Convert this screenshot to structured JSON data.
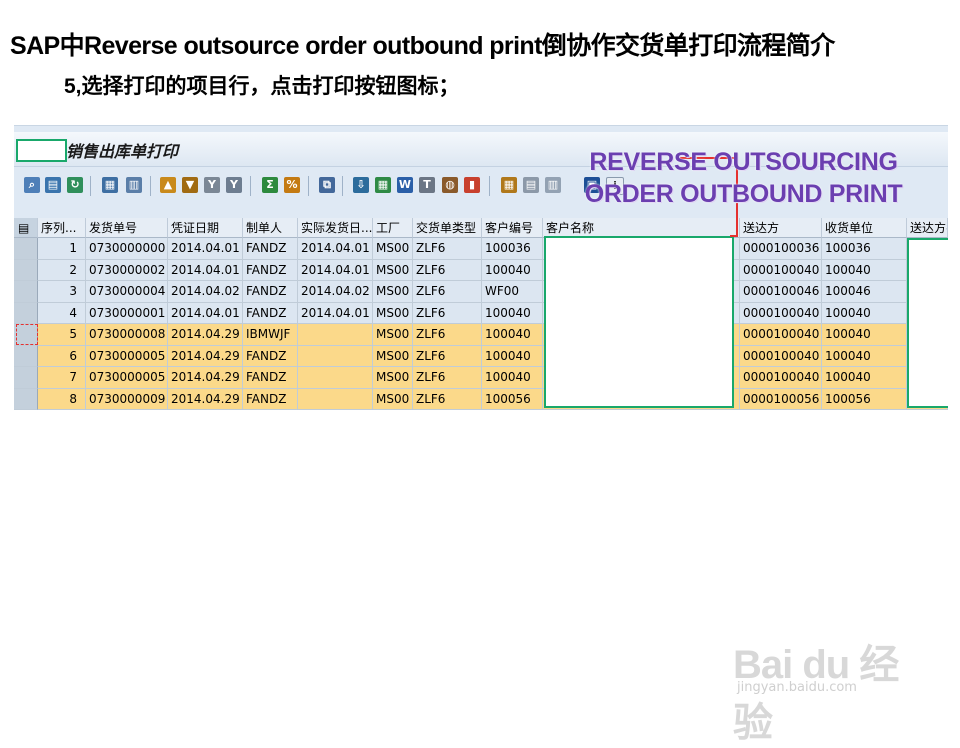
{
  "slide": {
    "title": "SAP中Reverse outsource order outbound print倒协作交货单打印流程简介",
    "step": "5,选择打印的项目行，点击打印按钮图标；"
  },
  "window": {
    "title": "销售出库单打印",
    "watermark_line1": "REVERSE OUTSOURCING",
    "watermark_line2": "ORDER OUTBOUND PRINT"
  },
  "toolbar": {
    "icons": [
      "find-icon",
      "detail-icon",
      "refresh-icon",
      "export-icon",
      "layout-icon",
      "sort-ascending-icon",
      "filter-icon",
      "filter-delete-icon",
      "sum-icon",
      "subtotal-icon",
      "print-preview-icon",
      "download-icon",
      "spreadsheet-icon",
      "word-icon",
      "abc-analysis-icon",
      "graphic-icon",
      "grid-icon",
      "choose-layout-icon",
      "save-layout-icon",
      "print-icon",
      "info-icon"
    ]
  },
  "table": {
    "columns": [
      "序列...",
      "发货单号",
      "凭证日期",
      "制单人",
      "实际发货日...",
      "工厂",
      "交货单类型",
      "客户编号",
      "客户名称",
      "送达方",
      "收货单位",
      "送达方名"
    ],
    "rows": [
      {
        "seq": "1",
        "doc": "0730000000",
        "date": "2014.04.01",
        "creator": "FANDZ",
        "ship_date": "2014.04.01",
        "plant": "MS00",
        "type": "ZLF6",
        "cust": "100036",
        "ship_to": "0000100036",
        "receiver": "100036",
        "status": "normal"
      },
      {
        "seq": "2",
        "doc": "0730000002",
        "date": "2014.04.01",
        "creator": "FANDZ",
        "ship_date": "2014.04.01",
        "plant": "MS00",
        "type": "ZLF6",
        "cust": "100040",
        "ship_to": "0000100040",
        "receiver": "100040",
        "status": "normal"
      },
      {
        "seq": "3",
        "doc": "0730000004",
        "date": "2014.04.02",
        "creator": "FANDZ",
        "ship_date": "2014.04.02",
        "plant": "MS00",
        "type": "ZLF6",
        "cust": "WF00",
        "ship_to": "0000100046",
        "receiver": "100046",
        "status": "normal"
      },
      {
        "seq": "4",
        "doc": "0730000001",
        "date": "2014.04.01",
        "creator": "FANDZ",
        "ship_date": "2014.04.01",
        "plant": "MS00",
        "type": "ZLF6",
        "cust": "100040",
        "ship_to": "0000100040",
        "receiver": "100040",
        "status": "normal"
      },
      {
        "seq": "5",
        "doc": "0730000008",
        "date": "2014.04.29",
        "creator": "IBMWJF",
        "ship_date": "",
        "plant": "MS00",
        "type": "ZLF6",
        "cust": "100040",
        "ship_to": "0000100040",
        "receiver": "100040",
        "status": "pending"
      },
      {
        "seq": "6",
        "doc": "0730000005",
        "date": "2014.04.29",
        "creator": "FANDZ",
        "ship_date": "",
        "plant": "MS00",
        "type": "ZLF6",
        "cust": "100040",
        "ship_to": "0000100040",
        "receiver": "100040",
        "status": "pending"
      },
      {
        "seq": "7",
        "doc": "0730000005",
        "date": "2014.04.29",
        "creator": "FANDZ",
        "ship_date": "",
        "plant": "MS00",
        "type": "ZLF6",
        "cust": "100040",
        "ship_to": "0000100040",
        "receiver": "100040",
        "status": "pending"
      },
      {
        "seq": "8",
        "doc": "0730000009",
        "date": "2014.04.29",
        "creator": "FANDZ",
        "ship_date": "",
        "plant": "MS00",
        "type": "ZLF6",
        "cust": "100056",
        "ship_to": "0000100056",
        "receiver": "100056",
        "status": "pending"
      }
    ]
  },
  "watermark": {
    "brand": "Bai du 经验",
    "url": "jingyan.baidu.com"
  },
  "colors": {
    "row_normal": "#dce6f1",
    "row_pending": "#fbd98a",
    "highlight_green": "#19a86b",
    "callout_red": "#e5312f",
    "watermark_purple": "#6b3fb0"
  }
}
